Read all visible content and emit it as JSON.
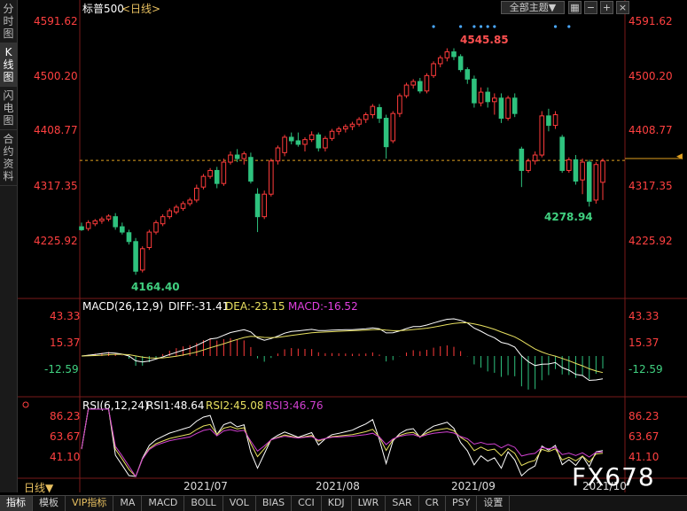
{
  "sidebar": {
    "tabs": [
      {
        "label": "分时图",
        "chars": [
          "分",
          "时",
          "图"
        ]
      },
      {
        "label": "K线图",
        "chars": [
          "K",
          "线",
          "图"
        ]
      },
      {
        "label": "闪电图",
        "chars": [
          "闪",
          "电",
          "图"
        ]
      },
      {
        "label": "合约资料",
        "chars": [
          "合",
          "约",
          "资",
          "料"
        ]
      }
    ]
  },
  "header": {
    "symbol": "标普500",
    "period_tag": "<日线>",
    "theme_select": "全部主题▼",
    "icon_names": [
      "grid-icon",
      "zoom-out-icon",
      "zoom-in-icon",
      "close-icon"
    ]
  },
  "price_panel": {
    "y_ticks": [
      "4591.62",
      "4500.20",
      "4408.77",
      "4317.35",
      "4225.92"
    ],
    "high_label": "4545.85",
    "low_label_left": "4164.40",
    "low_label_right": "4278.94"
  },
  "macd_panel": {
    "title": "MACD(26,12,9)",
    "diff": "DIFF:-31.41",
    "dea": "DEA:-23.15",
    "macd": "MACD:-16.52",
    "y_ticks": [
      "43.33",
      "15.37",
      "-12.59"
    ]
  },
  "rsi_panel": {
    "title": "RSI(6,12,24)",
    "rsi1": "RSI1:48.64",
    "rsi2": "RSI2:45.08",
    "rsi3": "RSI3:46.76",
    "y_ticks": [
      "86.23",
      "63.67",
      "41.10"
    ]
  },
  "x_axis": {
    "labels": [
      "2021/07",
      "2021/08",
      "2021/09",
      "2021/10"
    ]
  },
  "period_selector": "日线▼",
  "bottom_tabs": [
    "指标",
    "模板",
    "VIP指标",
    "MA",
    "MACD",
    "BOLL",
    "VOL",
    "BIAS",
    "CCI",
    "KDJ",
    "LWR",
    "SAR",
    "CR",
    "PSY",
    "设置"
  ],
  "watermark": "FX678",
  "colors": {
    "up": "#ff3b3b",
    "down": "#2ec27e",
    "axis_text": "#ff4040",
    "diff_line": "#ffffff",
    "dea_line": "#e8e060",
    "macd_label": "#e040e0",
    "rsi1": "#ffffff",
    "rsi2": "#e8e060",
    "rsi3": "#d040d0",
    "last_price_line": "#e0a020"
  },
  "chart_data": {
    "type": "candlestick",
    "title": "标普500",
    "ylim": [
      4164.4,
      4591.62
    ],
    "last_price": 4357,
    "candles": [
      {
        "o": 4245,
        "h": 4252,
        "l": 4238,
        "c": 4240
      },
      {
        "o": 4242,
        "h": 4256,
        "l": 4238,
        "c": 4252
      },
      {
        "o": 4250,
        "h": 4258,
        "l": 4246,
        "c": 4255
      },
      {
        "o": 4255,
        "h": 4262,
        "l": 4250,
        "c": 4258
      },
      {
        "o": 4258,
        "h": 4266,
        "l": 4254,
        "c": 4263
      },
      {
        "o": 4262,
        "h": 4268,
        "l": 4240,
        "c": 4245
      },
      {
        "o": 4245,
        "h": 4252,
        "l": 4232,
        "c": 4236
      },
      {
        "o": 4235,
        "h": 4240,
        "l": 4215,
        "c": 4220
      },
      {
        "o": 4220,
        "h": 4226,
        "l": 4164,
        "c": 4170
      },
      {
        "o": 4172,
        "h": 4212,
        "l": 4168,
        "c": 4208
      },
      {
        "o": 4210,
        "h": 4240,
        "l": 4206,
        "c": 4236
      },
      {
        "o": 4236,
        "h": 4256,
        "l": 4232,
        "c": 4252
      },
      {
        "o": 4250,
        "h": 4266,
        "l": 4246,
        "c": 4262
      },
      {
        "o": 4262,
        "h": 4276,
        "l": 4258,
        "c": 4272
      },
      {
        "o": 4270,
        "h": 4282,
        "l": 4266,
        "c": 4278
      },
      {
        "o": 4276,
        "h": 4288,
        "l": 4272,
        "c": 4284
      },
      {
        "o": 4284,
        "h": 4294,
        "l": 4280,
        "c": 4290
      },
      {
        "o": 4290,
        "h": 4316,
        "l": 4286,
        "c": 4310
      },
      {
        "o": 4312,
        "h": 4334,
        "l": 4308,
        "c": 4330
      },
      {
        "o": 4330,
        "h": 4344,
        "l": 4326,
        "c": 4340
      },
      {
        "o": 4340,
        "h": 4346,
        "l": 4310,
        "c": 4318
      },
      {
        "o": 4318,
        "h": 4360,
        "l": 4314,
        "c": 4354
      },
      {
        "o": 4354,
        "h": 4372,
        "l": 4350,
        "c": 4366
      },
      {
        "o": 4366,
        "h": 4376,
        "l": 4354,
        "c": 4360
      },
      {
        "o": 4360,
        "h": 4372,
        "l": 4350,
        "c": 4368
      },
      {
        "o": 4362,
        "h": 4370,
        "l": 4318,
        "c": 4322
      },
      {
        "o": 4300,
        "h": 4310,
        "l": 4236,
        "c": 4262
      },
      {
        "o": 4262,
        "h": 4306,
        "l": 4258,
        "c": 4300
      },
      {
        "o": 4300,
        "h": 4360,
        "l": 4296,
        "c": 4356
      },
      {
        "o": 4356,
        "h": 4382,
        "l": 4350,
        "c": 4378
      },
      {
        "o": 4370,
        "h": 4400,
        "l": 4364,
        "c": 4396
      },
      {
        "o": 4396,
        "h": 4404,
        "l": 4384,
        "c": 4390
      },
      {
        "o": 4390,
        "h": 4404,
        "l": 4380,
        "c": 4384
      },
      {
        "o": 4384,
        "h": 4396,
        "l": 4372,
        "c": 4392
      },
      {
        "o": 4392,
        "h": 4406,
        "l": 4388,
        "c": 4400
      },
      {
        "o": 4400,
        "h": 4404,
        "l": 4372,
        "c": 4378
      },
      {
        "o": 4378,
        "h": 4398,
        "l": 4372,
        "c": 4394
      },
      {
        "o": 4394,
        "h": 4410,
        "l": 4390,
        "c": 4406
      },
      {
        "o": 4406,
        "h": 4414,
        "l": 4400,
        "c": 4410
      },
      {
        "o": 4410,
        "h": 4418,
        "l": 4404,
        "c": 4414
      },
      {
        "o": 4414,
        "h": 4422,
        "l": 4408,
        "c": 4418
      },
      {
        "o": 4418,
        "h": 4430,
        "l": 4414,
        "c": 4426
      },
      {
        "o": 4426,
        "h": 4438,
        "l": 4420,
        "c": 4434
      },
      {
        "o": 4434,
        "h": 4452,
        "l": 4428,
        "c": 4448
      },
      {
        "o": 4446,
        "h": 4452,
        "l": 4420,
        "c": 4428
      },
      {
        "o": 4428,
        "h": 4434,
        "l": 4360,
        "c": 4380
      },
      {
        "o": 4390,
        "h": 4440,
        "l": 4386,
        "c": 4436
      },
      {
        "o": 4436,
        "h": 4470,
        "l": 4430,
        "c": 4466
      },
      {
        "o": 4466,
        "h": 4488,
        "l": 4462,
        "c": 4484
      },
      {
        "o": 4484,
        "h": 4494,
        "l": 4478,
        "c": 4490
      },
      {
        "o": 4490,
        "h": 4496,
        "l": 4470,
        "c": 4474
      },
      {
        "o": 4474,
        "h": 4504,
        "l": 4470,
        "c": 4500
      },
      {
        "o": 4500,
        "h": 4524,
        "l": 4496,
        "c": 4520
      },
      {
        "o": 4520,
        "h": 4534,
        "l": 4514,
        "c": 4530
      },
      {
        "o": 4530,
        "h": 4546,
        "l": 4524,
        "c": 4540
      },
      {
        "o": 4540,
        "h": 4546,
        "l": 4526,
        "c": 4532
      },
      {
        "o": 4532,
        "h": 4536,
        "l": 4506,
        "c": 4510
      },
      {
        "o": 4510,
        "h": 4514,
        "l": 4486,
        "c": 4494
      },
      {
        "o": 4494,
        "h": 4500,
        "l": 4446,
        "c": 4454
      },
      {
        "o": 4454,
        "h": 4480,
        "l": 4448,
        "c": 4472
      },
      {
        "o": 4472,
        "h": 4480,
        "l": 4446,
        "c": 4456
      },
      {
        "o": 4456,
        "h": 4470,
        "l": 4434,
        "c": 4462
      },
      {
        "o": 4462,
        "h": 4470,
        "l": 4420,
        "c": 4428
      },
      {
        "o": 4428,
        "h": 4466,
        "l": 4424,
        "c": 4462
      },
      {
        "o": 4462,
        "h": 4470,
        "l": 4430,
        "c": 4436
      },
      {
        "o": 4376,
        "h": 4380,
        "l": 4312,
        "c": 4340
      },
      {
        "o": 4340,
        "h": 4360,
        "l": 4336,
        "c": 4356
      },
      {
        "o": 4356,
        "h": 4372,
        "l": 4350,
        "c": 4366
      },
      {
        "o": 4366,
        "h": 4440,
        "l": 4362,
        "c": 4432
      },
      {
        "o": 4432,
        "h": 4444,
        "l": 4406,
        "c": 4416
      },
      {
        "o": 4416,
        "h": 4440,
        "l": 4410,
        "c": 4434
      },
      {
        "o": 4396,
        "h": 4400,
        "l": 4336,
        "c": 4340
      },
      {
        "o": 4340,
        "h": 4362,
        "l": 4336,
        "c": 4358
      },
      {
        "o": 4358,
        "h": 4366,
        "l": 4316,
        "c": 4322
      },
      {
        "o": 4324,
        "h": 4360,
        "l": 4300,
        "c": 4354
      },
      {
        "o": 4354,
        "h": 4358,
        "l": 4279,
        "c": 4288
      },
      {
        "o": 4290,
        "h": 4354,
        "l": 4284,
        "c": 4350
      },
      {
        "o": 4320,
        "h": 4360,
        "l": 4290,
        "c": 4356
      }
    ],
    "dot_candle_indices": [
      52,
      56,
      58,
      59,
      60,
      61,
      70,
      72
    ]
  }
}
